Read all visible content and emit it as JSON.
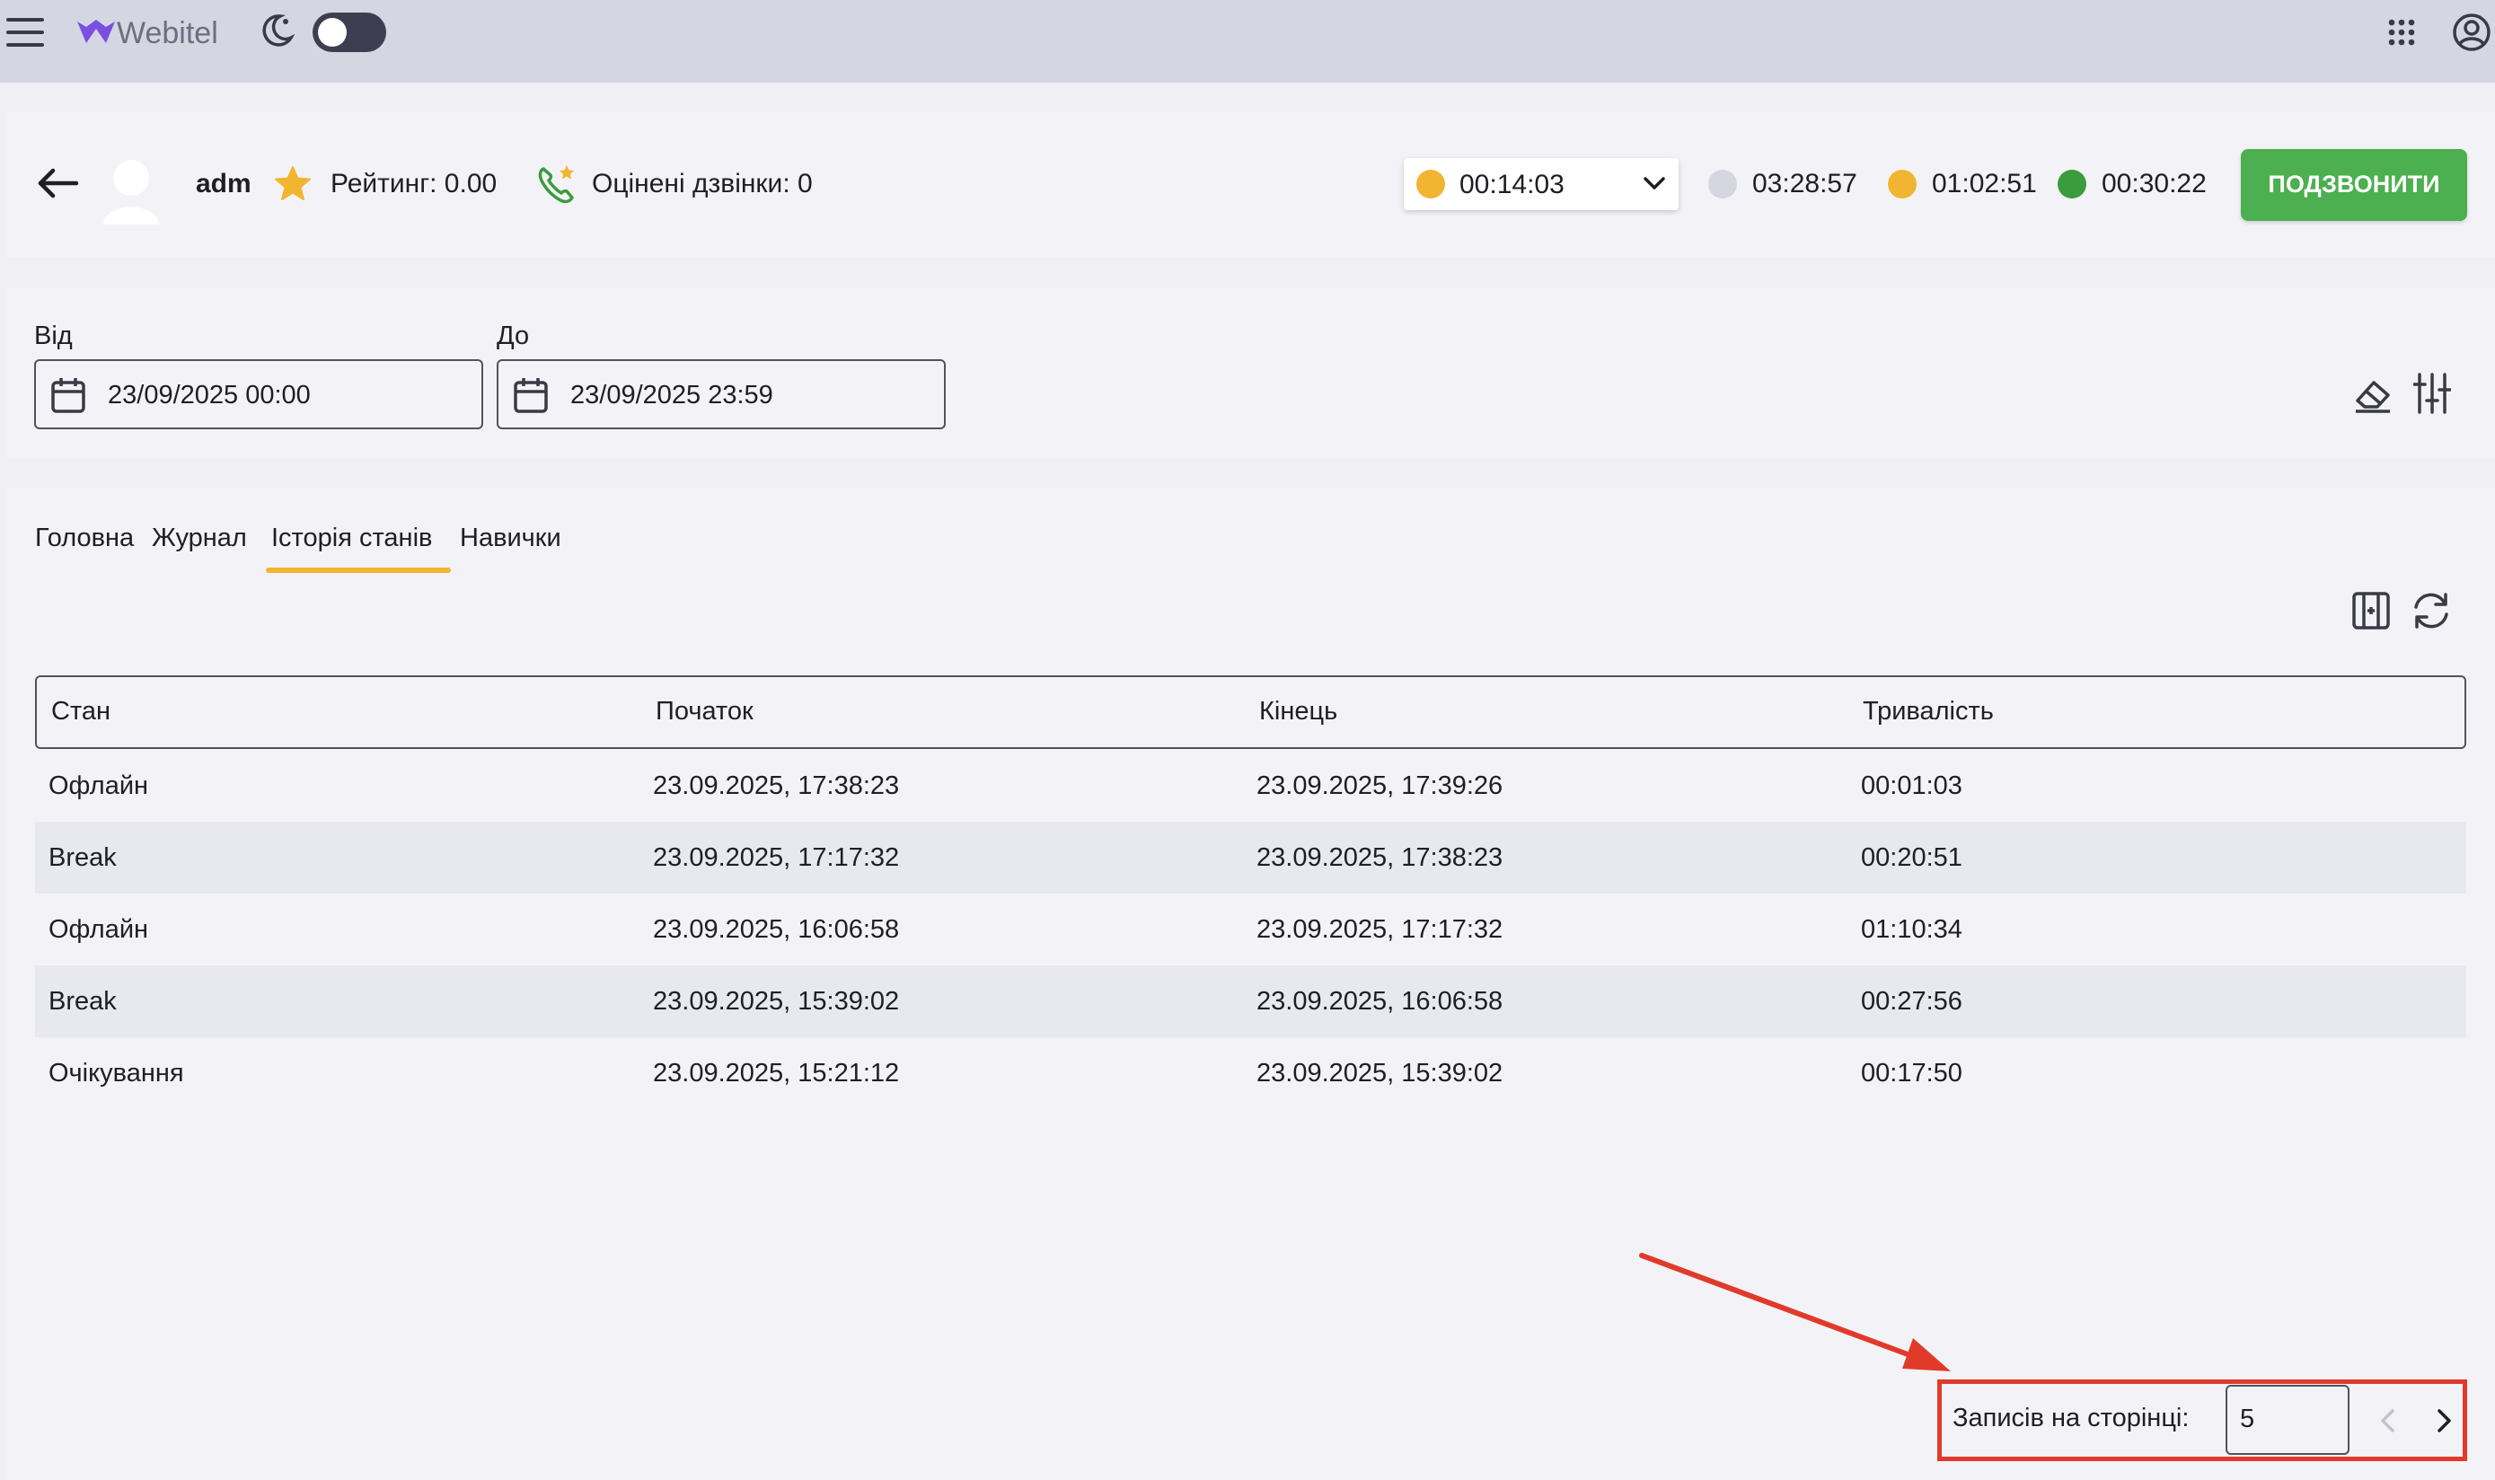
{
  "app": {
    "brand": "Webitel"
  },
  "agent": {
    "name": "adm",
    "rating": "Рейтинг: 0.00",
    "rated_calls": "Оцінені дзвінки: 0"
  },
  "status": {
    "current": {
      "time": "00:14:03",
      "color": "#f2b531"
    },
    "counters": [
      {
        "time": "03:28:57",
        "color": "#d5d6e0"
      },
      {
        "time": "01:02:51",
        "color": "#f2b531"
      },
      {
        "time": "00:30:22",
        "color": "#3a9c3d"
      }
    ]
  },
  "call_button": {
    "label": "ПОДЗВОНИТИ",
    "color": "#4caf50"
  },
  "filters": {
    "from_label": "Від",
    "from_value": "23/09/2025 00:00",
    "to_label": "До",
    "to_value": "23/09/2025 23:59"
  },
  "tabs": [
    {
      "label": "Головна",
      "active": false
    },
    {
      "label": "Журнал",
      "active": false
    },
    {
      "label": "Історія станів",
      "active": true
    },
    {
      "label": "Навички",
      "active": false
    }
  ],
  "table": {
    "columns": [
      "Стан",
      "Початок",
      "Кінець",
      "Тривалість"
    ],
    "rows": [
      [
        "Офлайн",
        "23.09.2025, 17:38:23",
        "23.09.2025, 17:39:26",
        "00:01:03"
      ],
      [
        "Break",
        "23.09.2025, 17:17:32",
        "23.09.2025, 17:38:23",
        "00:20:51"
      ],
      [
        "Офлайн",
        "23.09.2025, 16:06:58",
        "23.09.2025, 17:17:32",
        "01:10:34"
      ],
      [
        "Break",
        "23.09.2025, 15:39:02",
        "23.09.2025, 16:06:58",
        "00:27:56"
      ],
      [
        "Очікування",
        "23.09.2025, 15:21:12",
        "23.09.2025, 15:39:02",
        "00:17:50"
      ]
    ]
  },
  "pagination": {
    "per_page_label": "Записів на сторінці:",
    "per_page_value": "5"
  },
  "colors": {
    "accent_tab": "#f2b531",
    "annotation": "#e13a2b",
    "brand": "#7b4fe0"
  }
}
